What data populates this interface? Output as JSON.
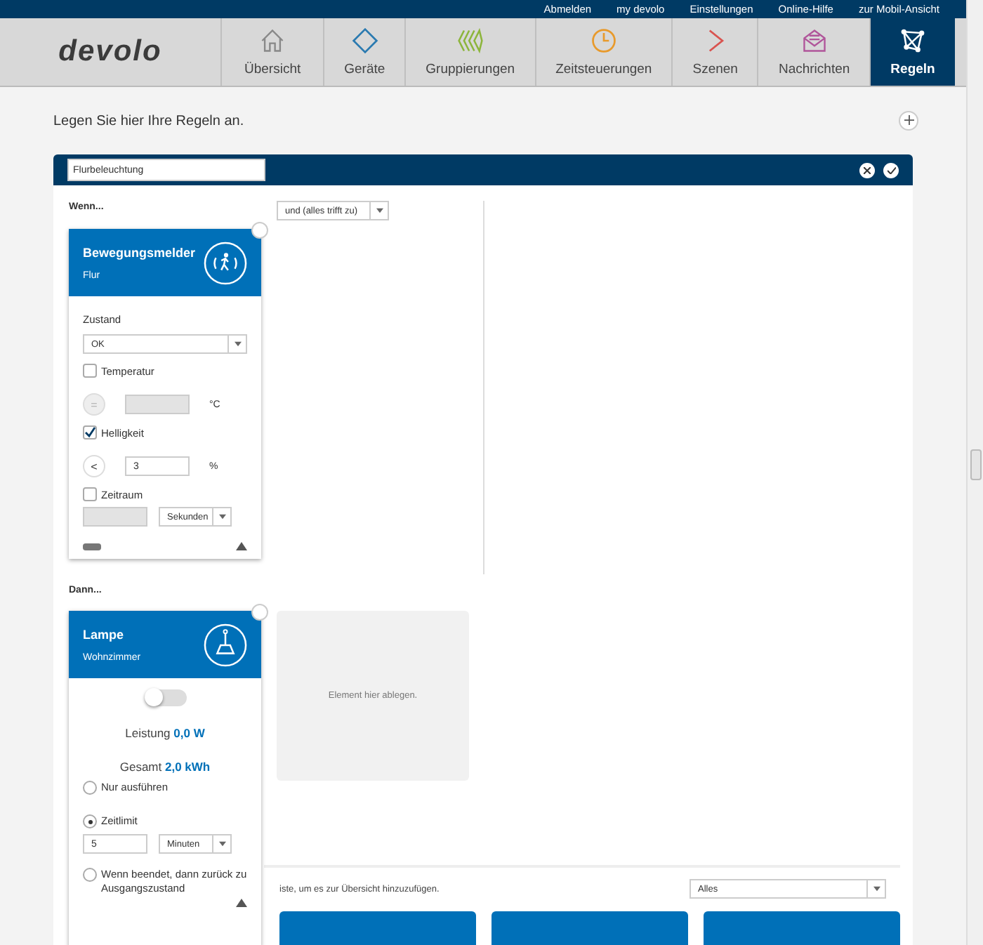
{
  "top_links": [
    "Abmelden",
    "my devolo",
    "Einstellungen",
    "Online-Hilfe",
    "zur Mobil-Ansicht"
  ],
  "logo": "devolo",
  "tabs": [
    {
      "label": "Übersicht",
      "selected": false
    },
    {
      "label": "Geräte",
      "selected": false
    },
    {
      "label": "Gruppierungen",
      "selected": false
    },
    {
      "label": "Zeitsteuerungen",
      "selected": false
    },
    {
      "label": "Szenen",
      "selected": false
    },
    {
      "label": "Nachrichten",
      "selected": false
    },
    {
      "label": "Regeln",
      "selected": true
    }
  ],
  "intro": "Legen Sie hier Ihre Regeln an.",
  "rule": {
    "name": "Flurbeleuchtung",
    "when_label": "Wenn...",
    "logic": "und (alles trifft zu)",
    "then_label": "Dann...",
    "trigger": {
      "title": "Bewegungsmelder",
      "room": "Flur",
      "state_label": "Zustand",
      "state_value": "OK",
      "conditions": [
        {
          "kind": "compare",
          "label": "Temperatur",
          "checked": false,
          "operator": "=",
          "unit": "°C"
        },
        {
          "kind": "compare",
          "label": "Helligkeit",
          "checked": true,
          "operator": "<",
          "value": "3",
          "unit": "%"
        },
        {
          "kind": "period",
          "label": "Zeitraum",
          "checked": false,
          "unit": "Sekunden"
        }
      ]
    },
    "action": {
      "title": "Lampe",
      "room": "Wohnzimmer",
      "on": false,
      "power_label": "Leistung",
      "power": "0,0 W",
      "total_label": "Gesamt",
      "total": "2,0 kWh",
      "options": [
        {
          "label": "Nur ausführen",
          "selected": false
        },
        {
          "label": "Zeitlimit",
          "selected": true,
          "value": "5",
          "unit": "Minuten"
        },
        {
          "label": "Wenn beendet, dann zurück zu Ausgangszustand",
          "selected": false
        }
      ]
    },
    "drop_hint": "Element hier ablegen."
  },
  "device_list": {
    "hint": "iste, um es zur Übersicht hinzuzufügen.",
    "filter": "Alles",
    "tiles": [
      {
        "kind": "device"
      },
      {
        "kind": "device"
      },
      {
        "kind": "device"
      }
    ]
  }
}
